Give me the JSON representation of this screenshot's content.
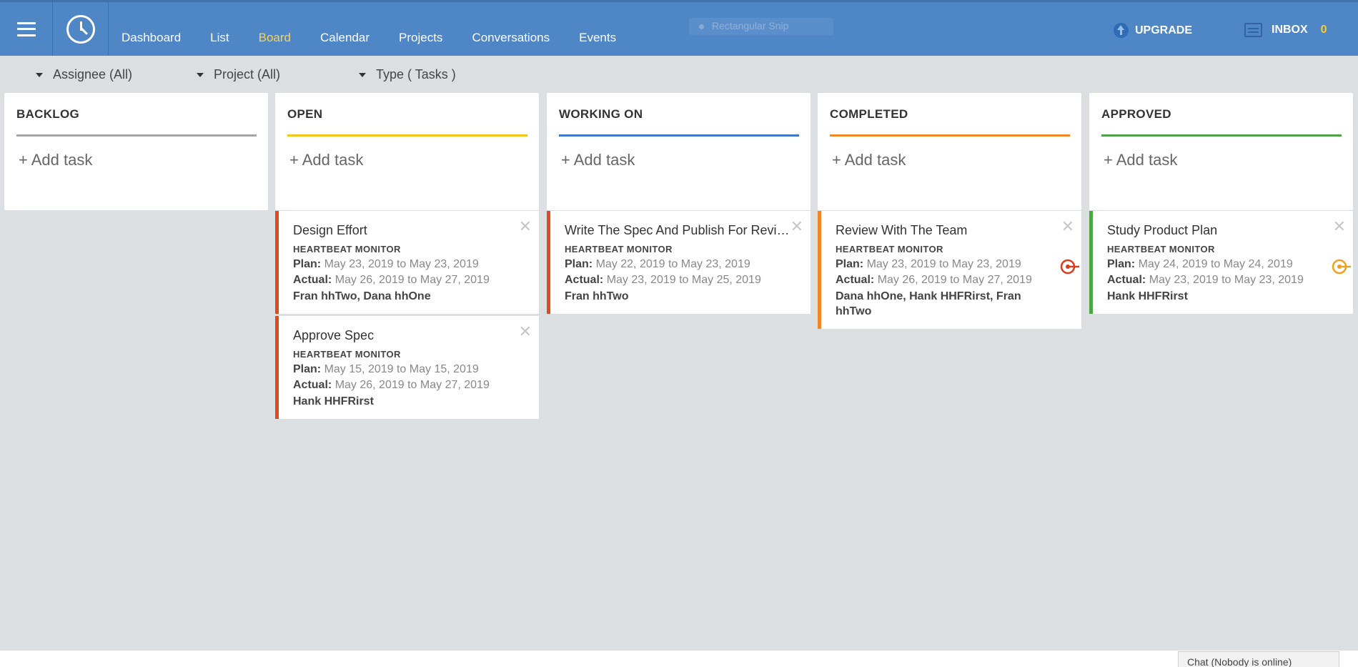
{
  "nav": {
    "items": [
      "Dashboard",
      "List",
      "Board",
      "Calendar",
      "Projects",
      "Conversations",
      "Events"
    ],
    "active": "Board"
  },
  "snip_label": "Rectangular Snip",
  "upgrade_label": "UPGRADE",
  "inbox": {
    "label": "INBOX",
    "count": "0"
  },
  "filters": {
    "assignee": "Assignee (All)",
    "project": "Project (All)",
    "type": "Type ( Tasks )"
  },
  "add_task_label": "+ Add task",
  "columns": [
    {
      "title": "BACKLOG",
      "accent": "#a6a6a6"
    },
    {
      "title": "OPEN",
      "accent": "#f5c518"
    },
    {
      "title": "WORKING ON",
      "accent": "#3f7ac8"
    },
    {
      "title": "COMPLETED",
      "accent": "#f0882a"
    },
    {
      "title": "APPROVED",
      "accent": "#4ea346"
    }
  ],
  "labels": {
    "plan": "Plan:",
    "actual": "Actual:",
    "to": "to"
  },
  "cards": {
    "open_1": {
      "title": "Design Effort",
      "project": "HEARTBEAT MONITOR",
      "plan_from": "May 23, 2019",
      "plan_to": "May 23, 2019",
      "actual_from": "May 26, 2019",
      "actual_to": "May 27, 2019",
      "people": "Fran hhTwo, Dana hhOne",
      "stripe": "#e04a1f"
    },
    "open_2": {
      "title": "Approve Spec",
      "project": "HEARTBEAT MONITOR",
      "plan_from": "May 15, 2019",
      "plan_to": "May 15, 2019",
      "actual_from": "May 26, 2019",
      "actual_to": "May 27, 2019",
      "people": "Hank HHFRirst",
      "stripe": "#e04a1f"
    },
    "working_1": {
      "title": "Write The Spec And Publish For Review",
      "project": "HEARTBEAT MONITOR",
      "plan_from": "May 22, 2019",
      "plan_to": "May 23, 2019",
      "actual_from": "May 23, 2019",
      "actual_to": "May 25, 2019",
      "people": "Fran hhTwo",
      "stripe": "#e04a1f"
    },
    "completed_1": {
      "title": "Review With The Team",
      "project": "HEARTBEAT MONITOR",
      "plan_from": "May 23, 2019",
      "plan_to": "May 23, 2019",
      "actual_from": "May 26, 2019",
      "actual_to": "May 27, 2019",
      "people": "Dana hhOne, Hank HHFRirst, Fran hhTwo",
      "stripe": "#f0882a",
      "link_color": "#e0391f"
    },
    "approved_1": {
      "title": "Study Product Plan",
      "project": "HEARTBEAT MONITOR",
      "plan_from": "May 24, 2019",
      "plan_to": "May 24, 2019",
      "actual_from": "May 23, 2019",
      "actual_to": "May 23, 2019",
      "people": "Hank HHFRirst",
      "stripe": "#4ea346",
      "link_color": "#f0a020"
    }
  },
  "chat_label": "Chat (Nobody is online)"
}
